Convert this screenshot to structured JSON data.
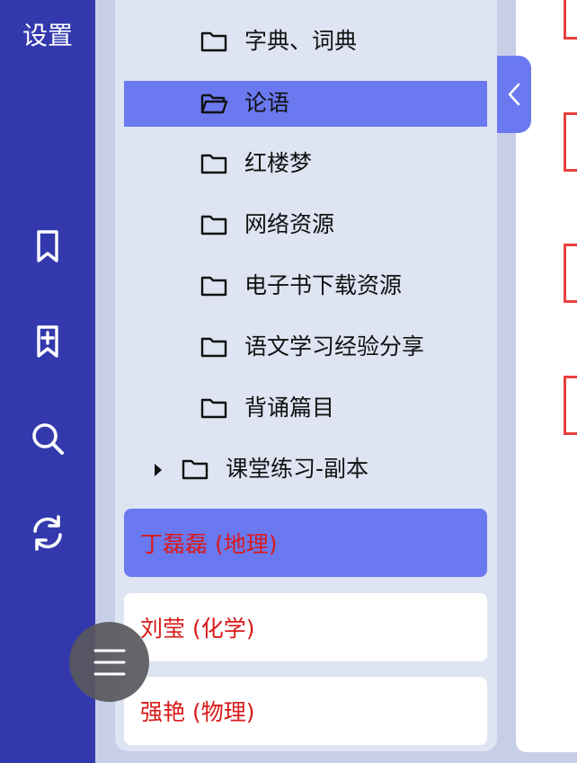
{
  "rail": {
    "title": "设置",
    "icons": [
      "bookmark-icon",
      "bookmark-add-icon",
      "search-icon",
      "refresh-icon"
    ]
  },
  "tree": {
    "items": [
      {
        "label": "字典、词典",
        "icon": "folder-icon"
      },
      {
        "label": "论语",
        "icon": "folder-open-icon",
        "selected": true
      },
      {
        "label": "红楼梦",
        "icon": "folder-icon"
      },
      {
        "label": "网络资源",
        "icon": "folder-icon"
      },
      {
        "label": "电子书下载资源",
        "icon": "folder-icon"
      },
      {
        "label": "语文学习经验分享",
        "icon": "folder-icon"
      },
      {
        "label": "背诵篇目",
        "icon": "folder-icon"
      },
      {
        "label": "课堂练习-副本",
        "icon": "folder-icon",
        "collapsed": true
      }
    ]
  },
  "users": [
    {
      "label": "丁磊磊 (地理)",
      "active": true
    },
    {
      "label": "刘莹 (化学)"
    },
    {
      "label": "强艳 (物理)"
    }
  ],
  "colors": {
    "rail": "#3339ad",
    "accent": "#6a79f0",
    "panel": "#dfe4f3",
    "user_text": "#d91a1a"
  }
}
